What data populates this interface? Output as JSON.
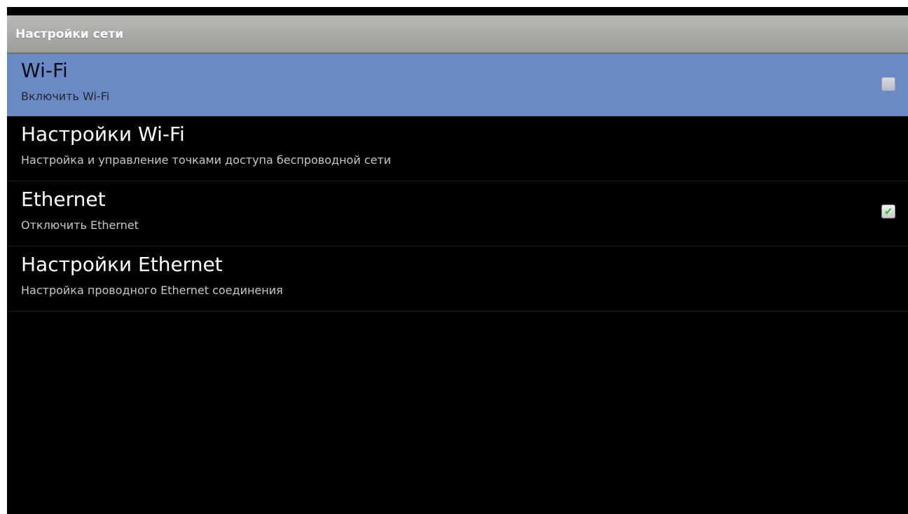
{
  "header": {
    "title": "Настройки сети"
  },
  "items": [
    {
      "title": "Wi-Fi",
      "summary": "Включить Wi-Fi",
      "checkbox": "disabled"
    },
    {
      "title": "Настройки Wi-Fi",
      "summary": "Настройка и управление точками доступа беспроводной сети"
    },
    {
      "title": "Ethernet",
      "summary": "Отключить Ethernet",
      "checkbox": "checked"
    },
    {
      "title": "Настройки Ethernet",
      "summary": "Настройка проводного Ethernet соединения"
    }
  ],
  "colors": {
    "selected_row": "#6a8ac6",
    "check_green": "#2fbf2f",
    "background": "#000000"
  },
  "icons": {
    "check": "check-icon"
  }
}
